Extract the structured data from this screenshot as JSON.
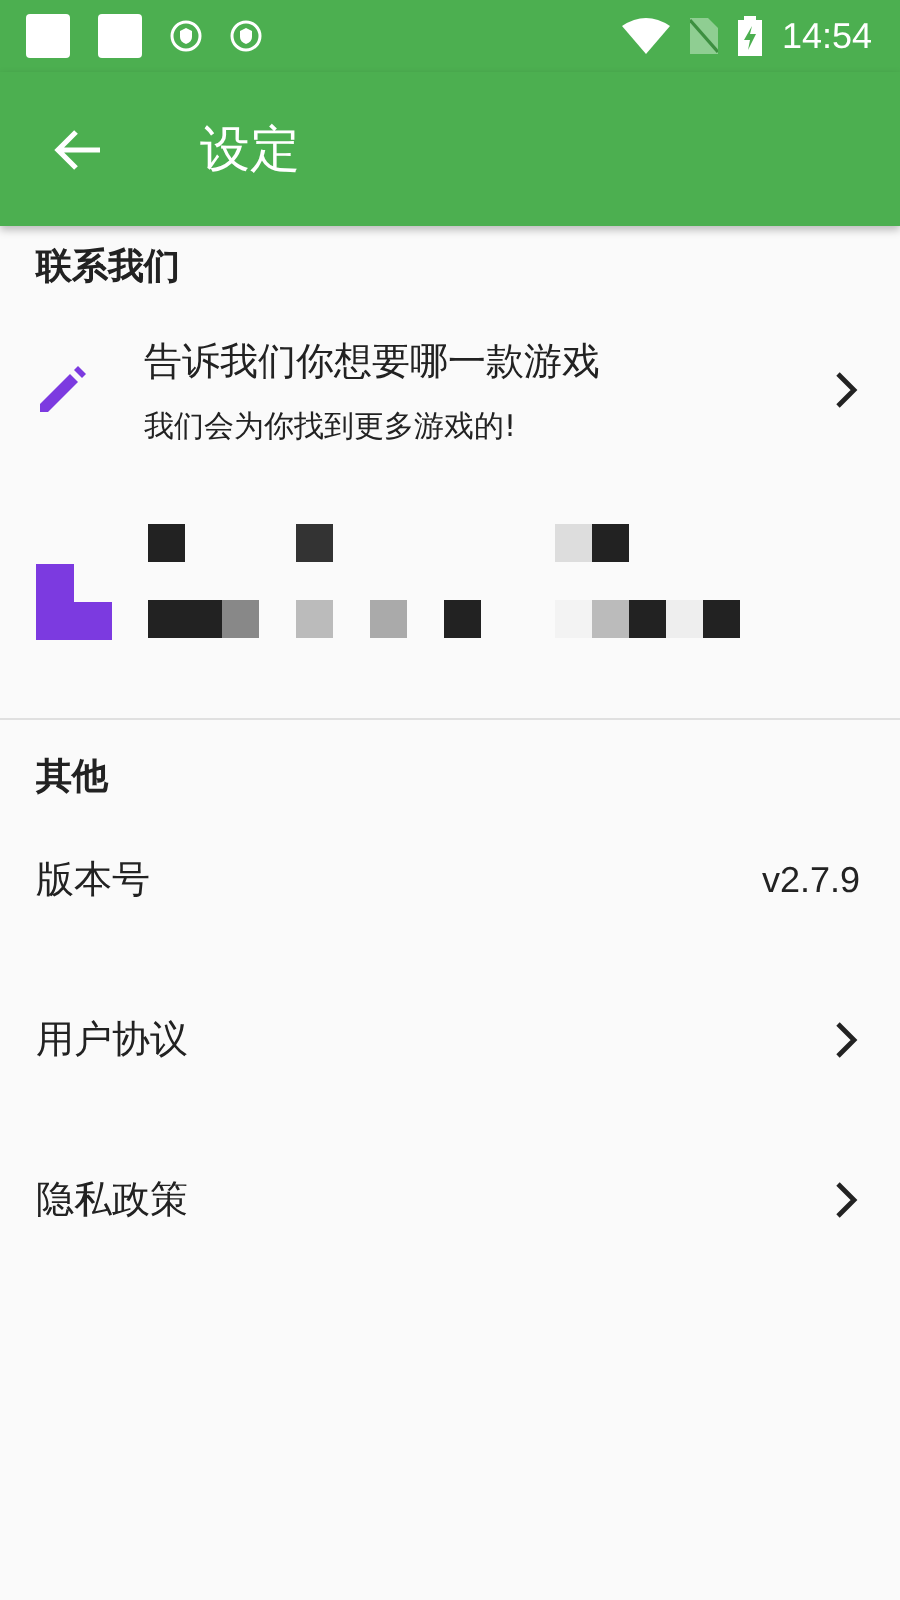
{
  "status_bar": {
    "time": "14:54"
  },
  "app_bar": {
    "title": "设定"
  },
  "sections": [
    {
      "header": "联系我们",
      "items": [
        {
          "kind": "link",
          "title": "告诉我们你想要哪一款游戏",
          "subtitle": "我们会为你找到更多游戏的!"
        },
        {
          "kind": "mosaic"
        }
      ]
    },
    {
      "header": "其他",
      "items": [
        {
          "kind": "value",
          "title": "版本号",
          "value": "v2.7.9"
        },
        {
          "kind": "nav",
          "title": "用户协议"
        },
        {
          "kind": "nav",
          "title": "隐私政策"
        }
      ]
    }
  ]
}
